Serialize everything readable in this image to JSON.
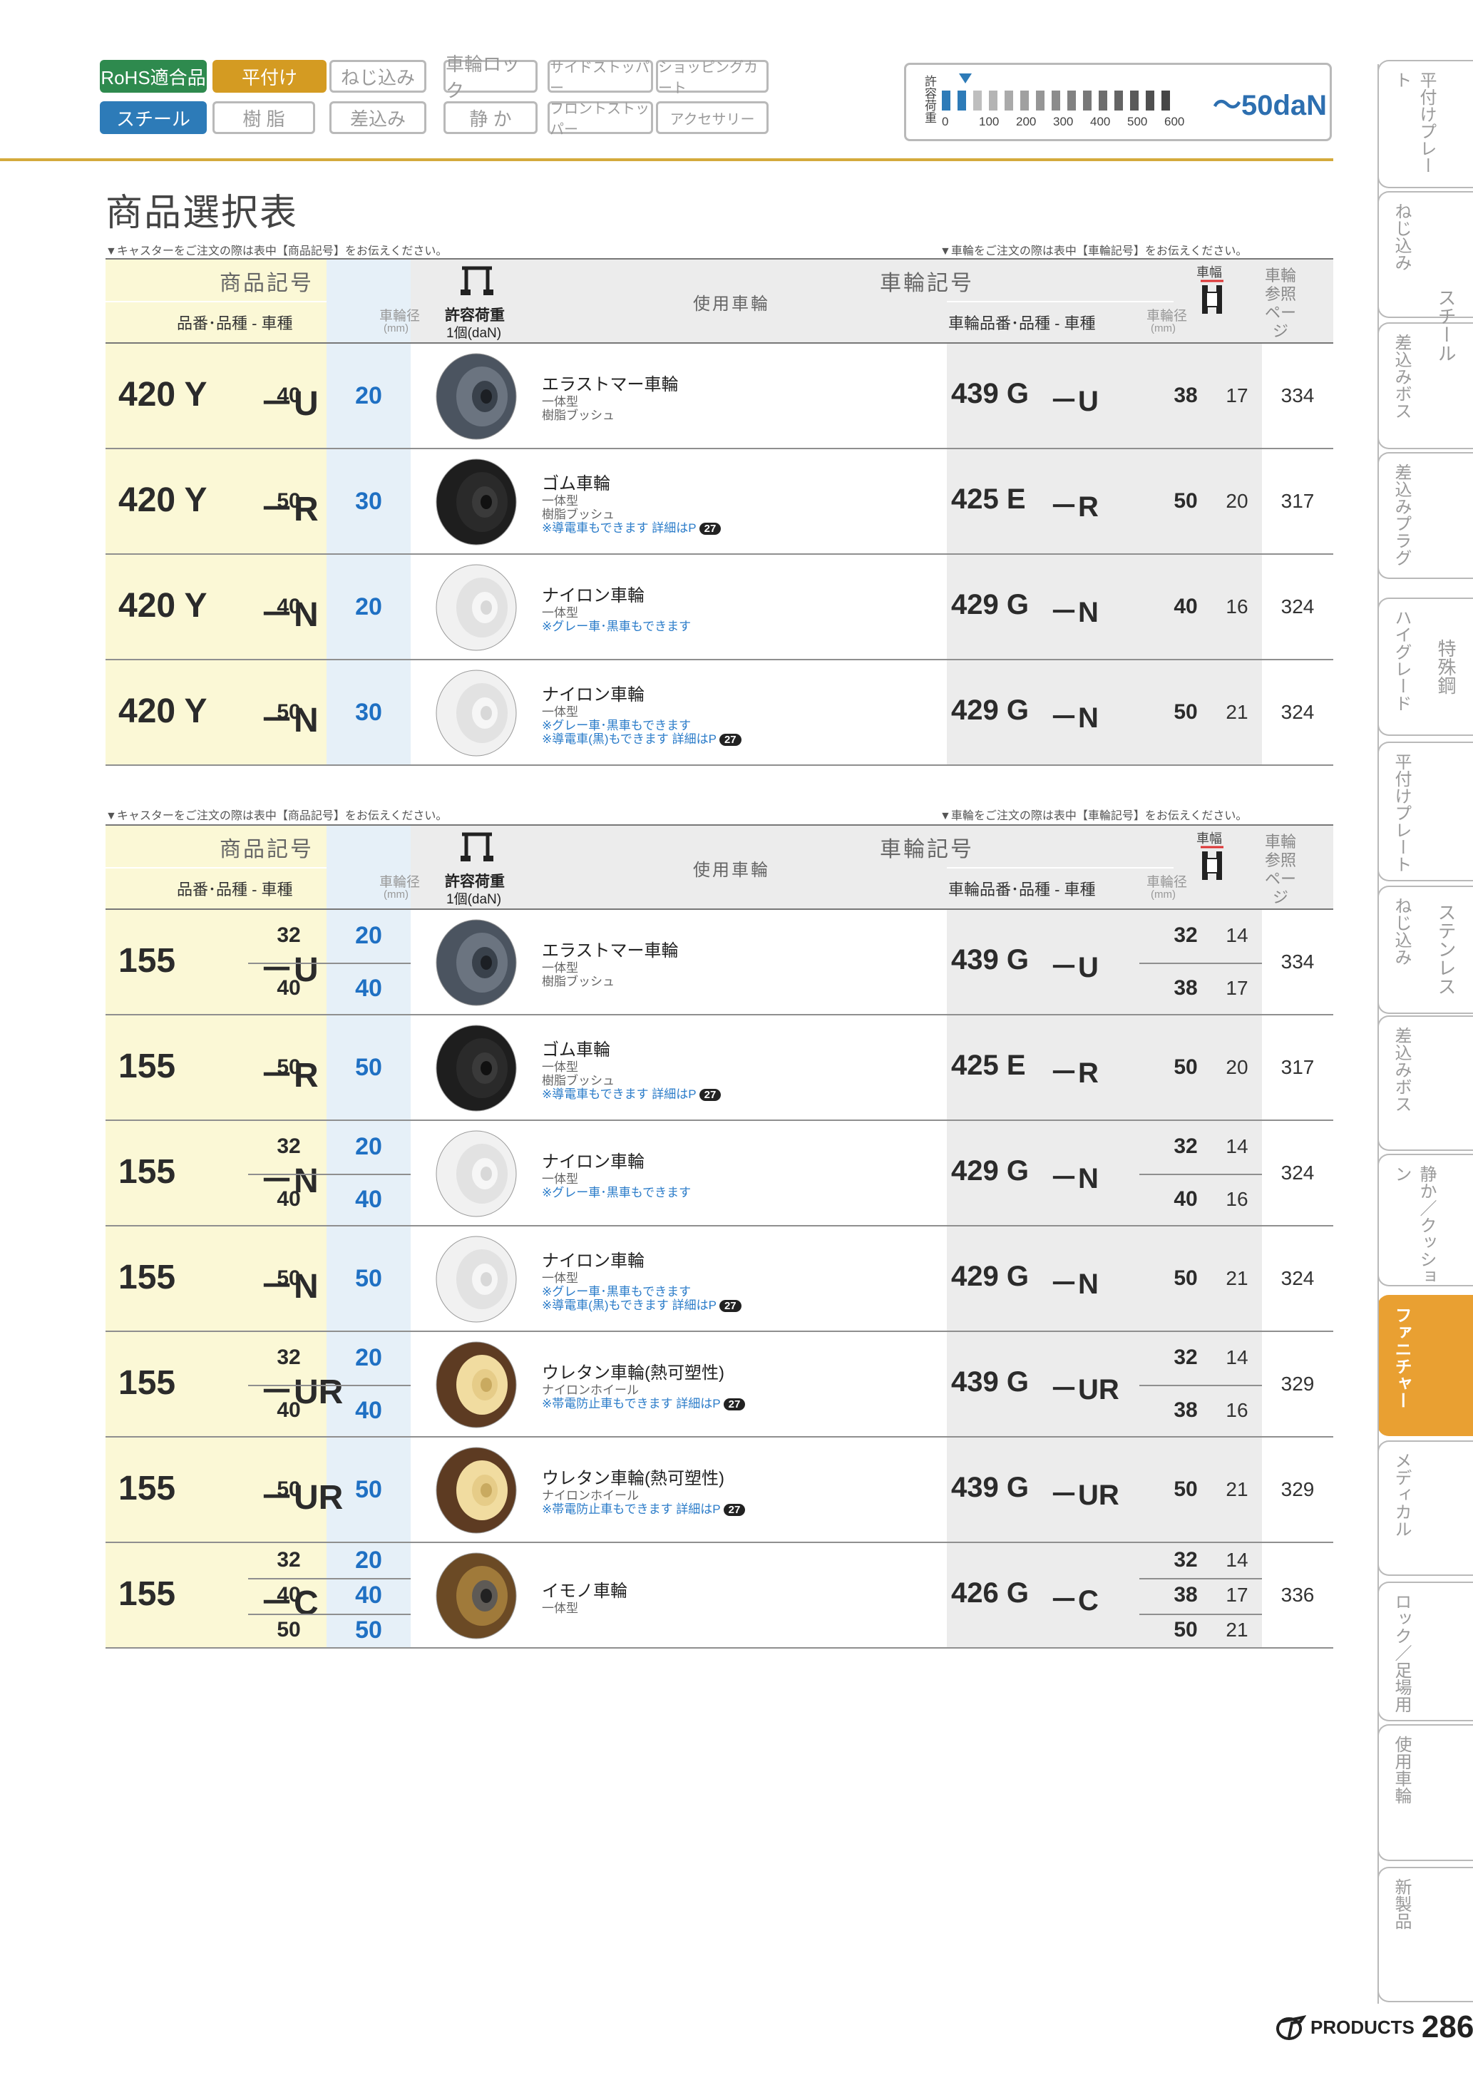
{
  "tags": [
    {
      "label": "RoHS適合品",
      "style": "green"
    },
    {
      "label": "平付け",
      "style": "gold"
    },
    {
      "label": "ねじ込み",
      "style": "grey"
    },
    {
      "label": "車輪ロック",
      "style": "grey"
    },
    {
      "label": "サイドストッパー",
      "style": "grey"
    },
    {
      "label": "ショッピングカート",
      "style": "grey"
    },
    {
      "label": "スチール",
      "style": "blue"
    },
    {
      "label": "樹 脂",
      "style": "grey"
    },
    {
      "label": "差込み",
      "style": "grey"
    },
    {
      "label": "静 か",
      "style": "grey"
    },
    {
      "label": "フロントストッパー",
      "style": "grey"
    },
    {
      "label": "アクセサリー",
      "style": "grey"
    }
  ],
  "load_scale": {
    "label": "許容荷重",
    "ticks": [
      "0",
      "100",
      "200",
      "300",
      "400",
      "500",
      "600"
    ],
    "value_label": "～50daN",
    "level_daN": 50,
    "max_daN": 600
  },
  "page_title": "商品選択表",
  "note_left": "▼キャスターをご注文の際は表中【商品記号】をお伝えください。",
  "note_right": "▼車輪をご注文の際は表中【車輪記号】をお伝えください。",
  "header": {
    "product_code": "商品記号",
    "product_sub": "品番･品種 - 車種",
    "wheel_dia": "車輪径",
    "mm": "(mm)",
    "allow_load": "許容荷重",
    "allow_load_unit": "1個(daN)",
    "wheel_used": "使用車輪",
    "wheel_code": "車輪記号",
    "wheel_sub": "車輪品番･品種 - 車種",
    "wheel_width": "車幅",
    "ref_page": "車輪参照ページ"
  },
  "table1": [
    {
      "code": "420 Y",
      "type": "－U",
      "dia": [
        "40"
      ],
      "load": [
        "20"
      ],
      "wheel": "elastomer",
      "name": "エラストマー車輪",
      "sub": [
        "一体型",
        "樹脂ブッシュ"
      ],
      "notes": [],
      "wcode": "439 G",
      "wtype": "－U",
      "wdia": [
        "38"
      ],
      "width": [
        "17"
      ],
      "page": "334"
    },
    {
      "code": "420 Y",
      "type": "－R",
      "dia": [
        "50"
      ],
      "load": [
        "30"
      ],
      "wheel": "rubber",
      "name": "ゴム車輪",
      "sub": [
        "一体型",
        "樹脂ブッシュ"
      ],
      "notes": [
        "※導電車もできます 詳細はP"
      ],
      "badge": "27",
      "wcode": "425 E",
      "wtype": "－R",
      "wdia": [
        "50"
      ],
      "width": [
        "20"
      ],
      "page": "317"
    },
    {
      "code": "420 Y",
      "type": "－N",
      "dia": [
        "40"
      ],
      "load": [
        "20"
      ],
      "wheel": "nylon",
      "name": "ナイロン車輪",
      "sub": [
        "一体型"
      ],
      "notes": [
        "※グレー車･黒車もできます"
      ],
      "wcode": "429 G",
      "wtype": "－N",
      "wdia": [
        "40"
      ],
      "width": [
        "16"
      ],
      "page": "324"
    },
    {
      "code": "420 Y",
      "type": "－N",
      "dia": [
        "50"
      ],
      "load": [
        "30"
      ],
      "wheel": "nylon",
      "name": "ナイロン車輪",
      "sub": [
        "一体型"
      ],
      "notes": [
        "※グレー車･黒車もできます",
        "※導電車(黒)もできます 詳細はP"
      ],
      "badge": "27",
      "wcode": "429 G",
      "wtype": "－N",
      "wdia": [
        "50"
      ],
      "width": [
        "21"
      ],
      "page": "324"
    }
  ],
  "table2": [
    {
      "code": "155",
      "type": "－U",
      "dia": [
        "32",
        "40"
      ],
      "load": [
        "20",
        "40"
      ],
      "wheel": "elastomer",
      "name": "エラストマー車輪",
      "sub": [
        "一体型",
        "樹脂ブッシュ"
      ],
      "notes": [],
      "wcode": "439 G",
      "wtype": "－U",
      "wdia": [
        "32",
        "38"
      ],
      "width": [
        "14",
        "17"
      ],
      "page": "334"
    },
    {
      "code": "155",
      "type": "－R",
      "dia": [
        "50"
      ],
      "load": [
        "50"
      ],
      "wheel": "rubber",
      "name": "ゴム車輪",
      "sub": [
        "一体型",
        "樹脂ブッシュ"
      ],
      "notes": [
        "※導電車もできます 詳細はP"
      ],
      "badge": "27",
      "wcode": "425 E",
      "wtype": "－R",
      "wdia": [
        "50"
      ],
      "width": [
        "20"
      ],
      "page": "317"
    },
    {
      "code": "155",
      "type": "－N",
      "dia": [
        "32",
        "40"
      ],
      "load": [
        "20",
        "40"
      ],
      "wheel": "nylon",
      "name": "ナイロン車輪",
      "sub": [
        "一体型"
      ],
      "notes": [
        "※グレー車･黒車もできます"
      ],
      "wcode": "429 G",
      "wtype": "－N",
      "wdia": [
        "32",
        "40"
      ],
      "width": [
        "14",
        "16"
      ],
      "page": "324"
    },
    {
      "code": "155",
      "type": "－N",
      "dia": [
        "50"
      ],
      "load": [
        "50"
      ],
      "wheel": "nylon",
      "name": "ナイロン車輪",
      "sub": [
        "一体型"
      ],
      "notes": [
        "※グレー車･黒車もできます",
        "※導電車(黒)もできます 詳細はP"
      ],
      "badge": "27",
      "wcode": "429 G",
      "wtype": "－N",
      "wdia": [
        "50"
      ],
      "width": [
        "21"
      ],
      "page": "324"
    },
    {
      "code": "155",
      "type": "－UR",
      "dia": [
        "32",
        "40"
      ],
      "load": [
        "20",
        "40"
      ],
      "wheel": "urethane",
      "name": "ウレタン車輪(熱可塑性)",
      "sub": [
        "ナイロンホイール"
      ],
      "notes": [
        "※帯電防止車もできます 詳細はP"
      ],
      "badge": "27",
      "wcode": "439 G",
      "wtype": "－UR",
      "wdia": [
        "32",
        "38"
      ],
      "width": [
        "14",
        "16"
      ],
      "page": "329"
    },
    {
      "code": "155",
      "type": "－UR",
      "dia": [
        "50"
      ],
      "load": [
        "50"
      ],
      "wheel": "urethane",
      "name": "ウレタン車輪(熱可塑性)",
      "sub": [
        "ナイロンホイール"
      ],
      "notes": [
        "※帯電防止車もできます 詳細はP"
      ],
      "badge": "27",
      "wcode": "439 G",
      "wtype": "－UR",
      "wdia": [
        "50"
      ],
      "width": [
        "21"
      ],
      "page": "329"
    },
    {
      "code": "155",
      "type": "－C",
      "dia": [
        "32",
        "40",
        "50"
      ],
      "load": [
        "20",
        "40",
        "50"
      ],
      "wheel": "cast",
      "name": "イモノ車輪",
      "sub": [
        "一体型"
      ],
      "notes": [],
      "wcode": "426 G",
      "wtype": "－C",
      "wdia": [
        "32",
        "38",
        "50"
      ],
      "width": [
        "14",
        "17",
        "21"
      ],
      "page": "336"
    }
  ],
  "side_tabs": [
    {
      "label": "平付けプレート",
      "active": false
    },
    {
      "label": "ねじ込み",
      "active": false
    },
    {
      "label": "差込みボス",
      "active": false
    },
    {
      "label": "差込みプラグ",
      "active": false
    },
    {
      "label": "ハイグレード",
      "active": false
    },
    {
      "label": "平付けプレート",
      "active": false
    },
    {
      "label": "ねじ込み",
      "active": false
    },
    {
      "label": "差込みボス",
      "active": false
    },
    {
      "label": "静か／クッション",
      "active": false
    },
    {
      "label": "ファニチャー",
      "active": true
    },
    {
      "label": "メディカル",
      "active": false
    },
    {
      "label": "ロック／足場用",
      "active": false
    },
    {
      "label": "使用車輪",
      "active": false
    },
    {
      "label": "新製品",
      "active": false
    }
  ],
  "side_categories": [
    "スチール",
    "特殊鋼",
    "ステンレス"
  ],
  "footer": {
    "brand": "PRODUCTS",
    "page": "286"
  },
  "colors": {
    "gold": "#d49b22",
    "green": "#2e8a4e",
    "blue": "#2d7bb8",
    "load_blue": "#1f70c3",
    "active_tab": "#e9a032"
  }
}
